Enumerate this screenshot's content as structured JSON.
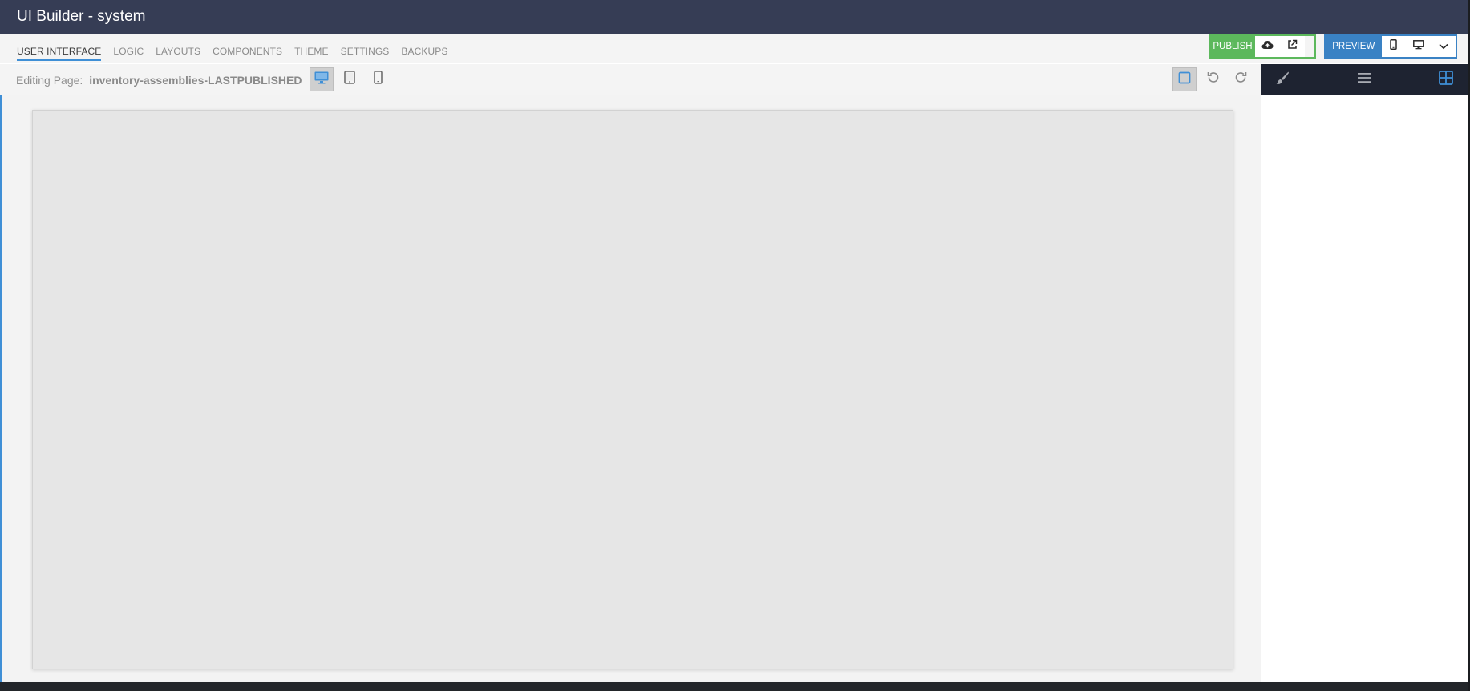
{
  "window": {
    "title": "UI Builder - system"
  },
  "tabs": [
    {
      "label": "USER INTERFACE",
      "active": true
    },
    {
      "label": "LOGIC"
    },
    {
      "label": "LAYOUTS"
    },
    {
      "label": "COMPONENTS"
    },
    {
      "label": "THEME"
    },
    {
      "label": "SETTINGS"
    },
    {
      "label": "BACKUPS"
    }
  ],
  "publish": {
    "label": "PUBLISH",
    "color": "#5cb85c",
    "icons": [
      "cloud-upload-icon",
      "external-link-icon"
    ]
  },
  "preview": {
    "label": "PREVIEW",
    "color": "#3a82c4",
    "icons": [
      "mobile-icon",
      "desktop-icon",
      "chevron-down-icon"
    ]
  },
  "toolbar": {
    "editing_prefix": "Editing Page:",
    "page_name": "inventory-assemblies-LASTPUBLISHED",
    "device_icons": [
      "desktop-icon",
      "tablet-icon",
      "phone-icon"
    ],
    "selected_device": "desktop",
    "right_icons": [
      "outline-toggle-icon",
      "undo-icon",
      "redo-icon"
    ]
  },
  "side_panel": {
    "icons": [
      "brush-icon",
      "menu-icon",
      "grid-icon"
    ],
    "active": "grid-icon"
  },
  "colors": {
    "title_bar": "#363d55",
    "accent": "#3f8fd6",
    "side_panel_header": "#1e2331"
  }
}
